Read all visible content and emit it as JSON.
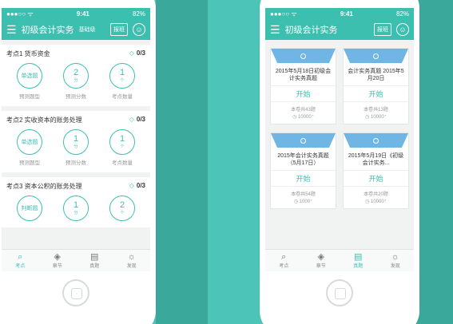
{
  "status": {
    "time": "9:41",
    "battery": "82%"
  },
  "left_screen": {
    "title": "初级会计实务",
    "subtitle": "基础级",
    "signup": "报班",
    "knowledge_points": [
      {
        "title": "考点1 货币资金",
        "progress": "0/3",
        "items": [
          {
            "value": "单选题",
            "unit": "",
            "label": "预测题型"
          },
          {
            "value": "2",
            "unit": "分",
            "label": "预测分数"
          },
          {
            "value": "1",
            "unit": "个",
            "label": "考点数量"
          }
        ]
      },
      {
        "title": "考点2 实收资本的账务处理",
        "progress": "0/3",
        "items": [
          {
            "value": "单选题",
            "unit": "",
            "label": "预测题型"
          },
          {
            "value": "1",
            "unit": "分",
            "label": "预测分数"
          },
          {
            "value": "1",
            "unit": "个",
            "label": "考点数量"
          }
        ]
      },
      {
        "title": "考点3 资本公积的账务处理",
        "progress": "0/3",
        "items": [
          {
            "value": "判断题",
            "unit": "",
            "label": ""
          },
          {
            "value": "1",
            "unit": "分",
            "label": ""
          },
          {
            "value": "2",
            "unit": "个",
            "label": ""
          }
        ]
      }
    ],
    "tabs": [
      {
        "label": "考点",
        "icon": "⌕"
      },
      {
        "label": "章节",
        "icon": "◈"
      },
      {
        "label": "真题",
        "icon": "▤"
      },
      {
        "label": "发现",
        "icon": "☼"
      }
    ]
  },
  "right_screen": {
    "title": "初级会计实务",
    "signup": "报班",
    "papers": [
      {
        "title": "2015年5月18日初级会计实务真题",
        "start": "开始",
        "count": "本卷共43题",
        "views": "10000⁺"
      },
      {
        "title": "会计实务真题 2015年5月20日",
        "start": "开始",
        "count": "本卷共13题",
        "views": "10000⁺"
      },
      {
        "title": "2015年会计实务真题（5月17日）",
        "start": "开始",
        "count": "本卷共54题",
        "views": "1000⁺"
      },
      {
        "title": "2015年5月19日《初级会计实务...",
        "start": "开始",
        "count": "本卷共20题",
        "views": "10000⁺"
      }
    ],
    "tabs": [
      {
        "label": "考点",
        "icon": "⌕"
      },
      {
        "label": "章节",
        "icon": "◈"
      },
      {
        "label": "真题",
        "icon": "▤"
      },
      {
        "label": "发现",
        "icon": "☼"
      }
    ]
  },
  "colors": {
    "accent": "#3dbfb0",
    "background": "#4cc5b8",
    "card_roof": "#6fb6e4"
  }
}
